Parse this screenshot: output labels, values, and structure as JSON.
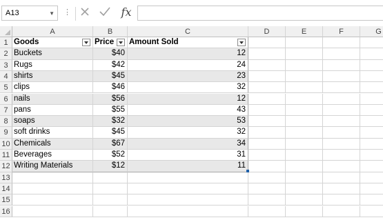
{
  "formula_bar": {
    "name_box": "A13",
    "cancel_icon": "x-icon",
    "enter_icon": "check-icon",
    "function_label": "fx",
    "formula": ""
  },
  "columns": [
    "A",
    "B",
    "C",
    "D",
    "E",
    "F",
    "G"
  ],
  "rows": [
    "1",
    "2",
    "3",
    "4",
    "5",
    "6",
    "7",
    "8",
    "9",
    "10",
    "11",
    "12",
    "13",
    "14",
    "15",
    "16"
  ],
  "table": {
    "headers": [
      "Goods",
      "Price",
      "Amount Sold"
    ],
    "data": [
      {
        "goods": "Buckets",
        "price": "$40",
        "amount": "12"
      },
      {
        "goods": "Rugs",
        "price": "$42",
        "amount": "24"
      },
      {
        "goods": "shirts",
        "price": "$45",
        "amount": "23"
      },
      {
        "goods": "clips",
        "price": "$46",
        "amount": "32"
      },
      {
        "goods": "nails",
        "price": "$56",
        "amount": "12"
      },
      {
        "goods": "pans",
        "price": "$55",
        "amount": "43"
      },
      {
        "goods": "soaps",
        "price": "$32",
        "amount": "53"
      },
      {
        "goods": "soft drinks",
        "price": "$45",
        "amount": "32"
      },
      {
        "goods": "Chemicals",
        "price": "$67",
        "amount": "34"
      },
      {
        "goods": "Beverages",
        "price": "$52",
        "amount": "31"
      },
      {
        "goods": "Writing Materials",
        "price": "$12",
        "amount": "11"
      }
    ]
  },
  "colors": {
    "band": "#e8e8e8",
    "header_bg": "#f0f0f0",
    "selection_handle": "#1f5fa8"
  }
}
